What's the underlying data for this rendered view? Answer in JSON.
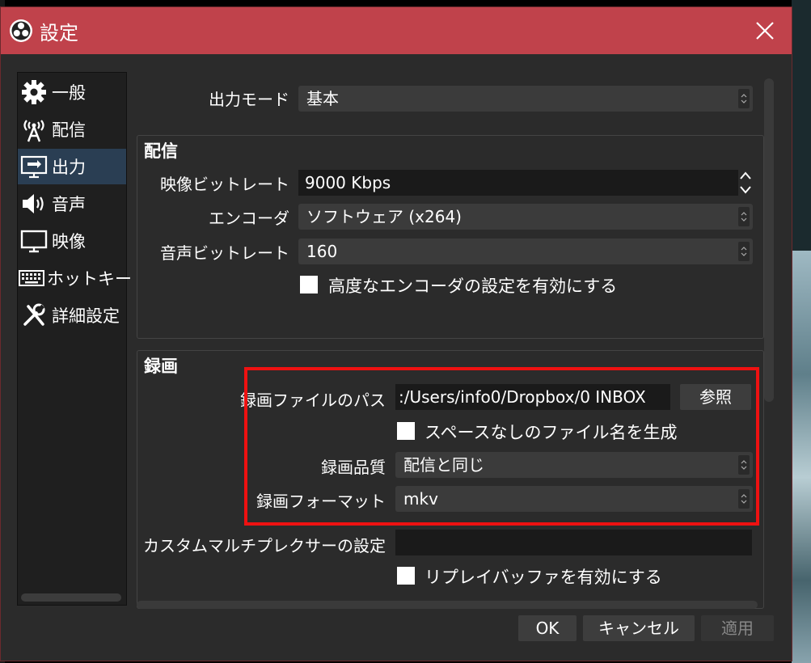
{
  "window": {
    "title": "設定"
  },
  "sidebar": {
    "items": [
      {
        "label": "一般",
        "icon": "gear-icon"
      },
      {
        "label": "配信",
        "icon": "broadcast-icon"
      },
      {
        "label": "出力",
        "icon": "output-monitor-icon"
      },
      {
        "label": "音声",
        "icon": "speaker-icon"
      },
      {
        "label": "映像",
        "icon": "monitor-icon"
      },
      {
        "label": "ホットキー",
        "icon": "keyboard-icon"
      },
      {
        "label": "詳細設定",
        "icon": "tools-icon"
      }
    ],
    "active_index": 2
  },
  "output": {
    "mode_label": "出力モード",
    "mode_value": "基本",
    "streaming": {
      "title": "配信",
      "video_bitrate_label": "映像ビットレート",
      "video_bitrate_value": "9000 Kbps",
      "encoder_label": "エンコーダ",
      "encoder_value": "ソフトウェア (x264)",
      "audio_bitrate_label": "音声ビットレート",
      "audio_bitrate_value": "160",
      "advanced_encoder_label": "高度なエンコーダの設定を有効にする",
      "advanced_encoder_checked": false
    },
    "recording": {
      "title": "録画",
      "path_label": "録画ファイルのパス",
      "path_value": ":/Users/info0/Dropbox/0 INBOX",
      "browse_label": "参照",
      "no_space_label": "スペースなしのファイル名を生成",
      "no_space_checked": false,
      "quality_label": "録画品質",
      "quality_value": "配信と同じ",
      "format_label": "録画フォーマット",
      "format_value": "mkv",
      "custom_muxer_label": "カスタムマルチプレクサーの設定",
      "custom_muxer_value": "",
      "replay_buffer_label": "リプレイバッファを有効にする",
      "replay_buffer_checked": false
    }
  },
  "buttons": {
    "ok": "OK",
    "cancel": "キャンセル",
    "apply": "適用"
  },
  "colors": {
    "titlebar": "#c0424b",
    "highlight": "#ee1111",
    "active_item": "#2a3e53"
  }
}
